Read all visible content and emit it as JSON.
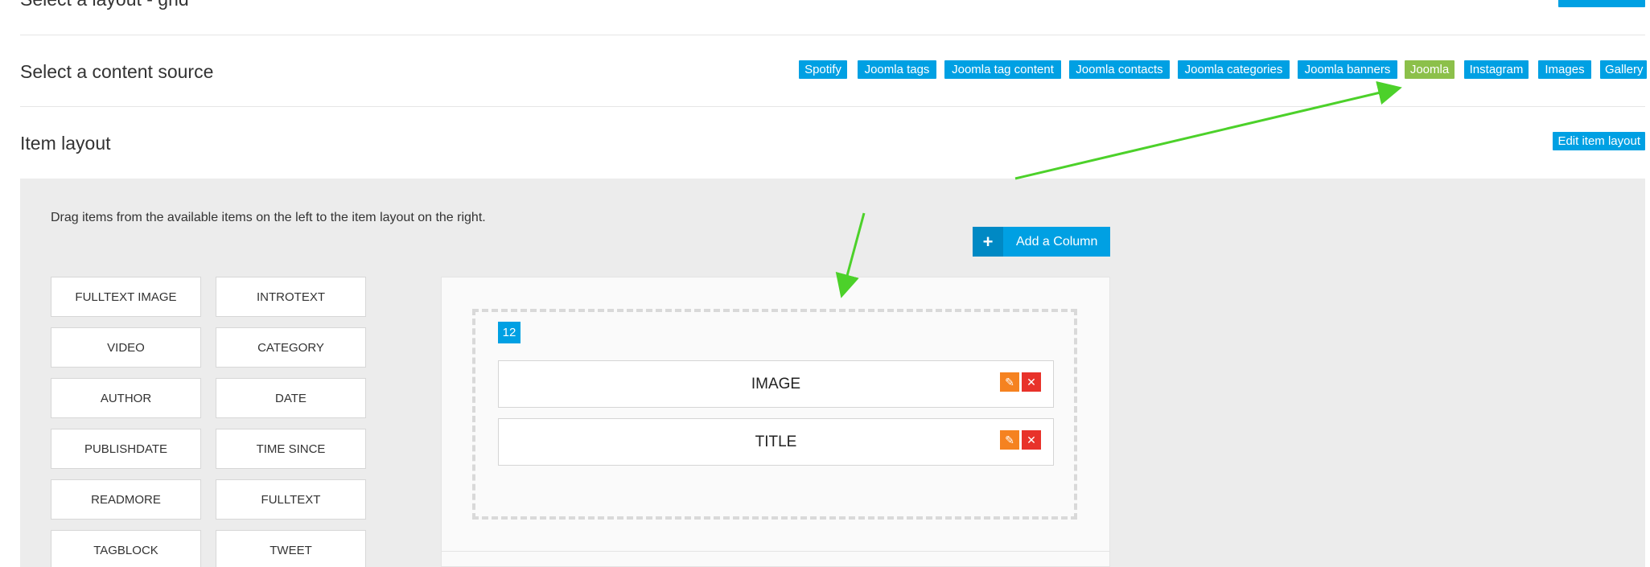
{
  "top_row": {
    "title": "Select a layout - grid"
  },
  "content_source": {
    "title": "Select a content source",
    "sources": [
      {
        "label": "Spotify",
        "active": false
      },
      {
        "label": "Joomla tags",
        "active": false
      },
      {
        "label": "Joomla tag content",
        "active": false
      },
      {
        "label": "Joomla contacts",
        "active": false
      },
      {
        "label": "Joomla categories",
        "active": false
      },
      {
        "label": "Joomla banners",
        "active": false
      },
      {
        "label": "Joomla",
        "active": true
      },
      {
        "label": "Instagram",
        "active": false
      },
      {
        "label": "Images",
        "active": false
      },
      {
        "label": "Gallery",
        "active": false
      }
    ]
  },
  "item_layout": {
    "title": "Item layout",
    "edit_button": "Edit item layout"
  },
  "builder": {
    "instructions": "Drag items from the available items on the left to the item layout on the right.",
    "add_column": "Add a Column",
    "available_items": [
      "FULLTEXT IMAGE",
      "INTROTEXT",
      "VIDEO",
      "CATEGORY",
      "AUTHOR",
      "DATE",
      "PUBLISHDATE",
      "TIME SINCE",
      "READMORE",
      "FULLTEXT",
      "TAGBLOCK",
      "TWEET"
    ],
    "column_width": "12",
    "layout_items": [
      "IMAGE",
      "TITLE"
    ]
  },
  "colors": {
    "primary": "#00a0e3",
    "active": "#8cc04a",
    "edit": "#f58220",
    "delete": "#e8322a",
    "annotation_arrow": "#4cd12a"
  }
}
